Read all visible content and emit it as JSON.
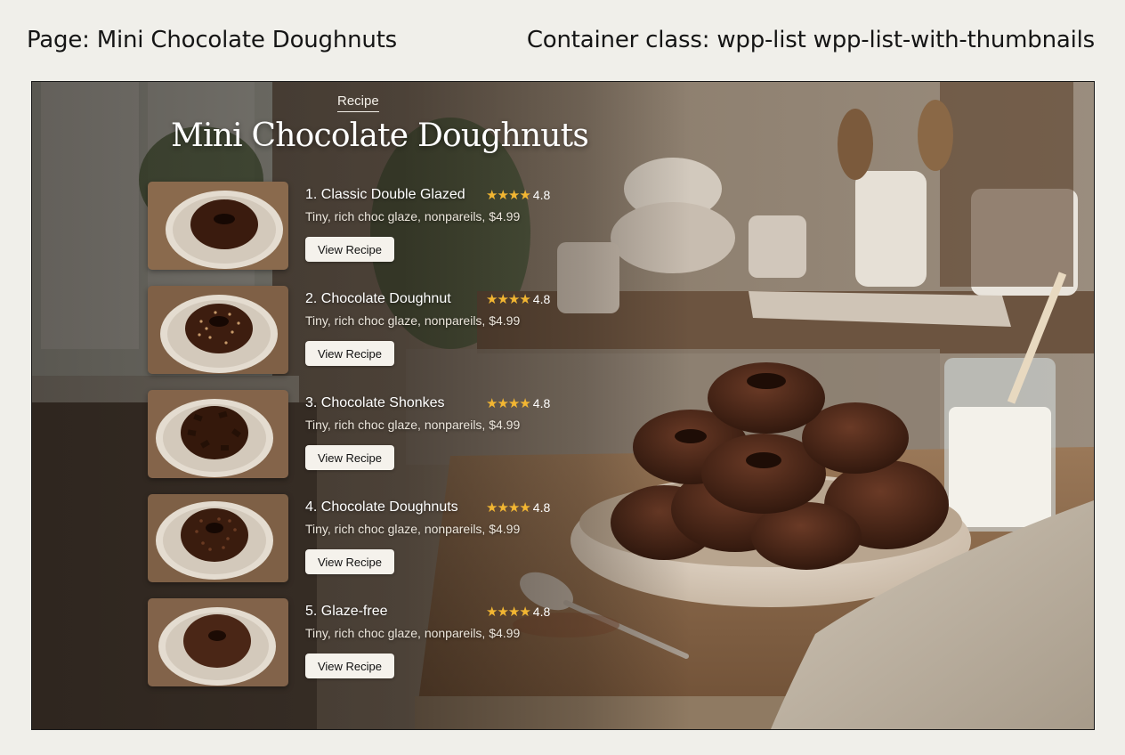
{
  "captions": {
    "page": "Page: Mini Chocolate Doughnuts",
    "container": "Container class: wpp-list wpp-list-with-thumbnails"
  },
  "hero": {
    "eyebrow": "Recipe",
    "title": "Mini Chocolate Doughnuts"
  },
  "colors": {
    "star": "#f2b632",
    "button_bg": "#f5f2ec",
    "title_text": "#ffffff"
  },
  "recipes": [
    {
      "title": "1. Classic Double Glazed",
      "stars": "★★★★",
      "rating": "4.8",
      "description": "Tiny, rich choc glaze, nonpareils, $4.99",
      "button": "View Recipe",
      "thumb_icon": "plain-glazed-doughnut"
    },
    {
      "title": "2. Chocolate Doughnut",
      "stars": "★★★★",
      "rating": "4.8",
      "description": "Tiny, rich choc glaze, nonpareils, $4.99",
      "button": "View Recipe",
      "thumb_icon": "sprinkled-doughnut"
    },
    {
      "title": "3. Chocolate Shonkes",
      "stars": "★★★★",
      "rating": "4.8",
      "description": "Tiny, rich choc glaze, nonpareils, $4.99",
      "button": "View Recipe",
      "thumb_icon": "chunky-doughnut"
    },
    {
      "title": "4. Chocolate Doughnuts",
      "stars": "★★★★",
      "rating": "4.8",
      "description": "Tiny, rich choc glaze, nonpareils, $4.99",
      "button": "View Recipe",
      "thumb_icon": "sprinkled-doughnut"
    },
    {
      "title": "5. Glaze-free",
      "stars": "★★★★",
      "rating": "4.8",
      "description": "Tiny, rich choc glaze, nonpareils, $4.99",
      "button": "View Recipe",
      "thumb_icon": "plain-doughnut"
    }
  ]
}
